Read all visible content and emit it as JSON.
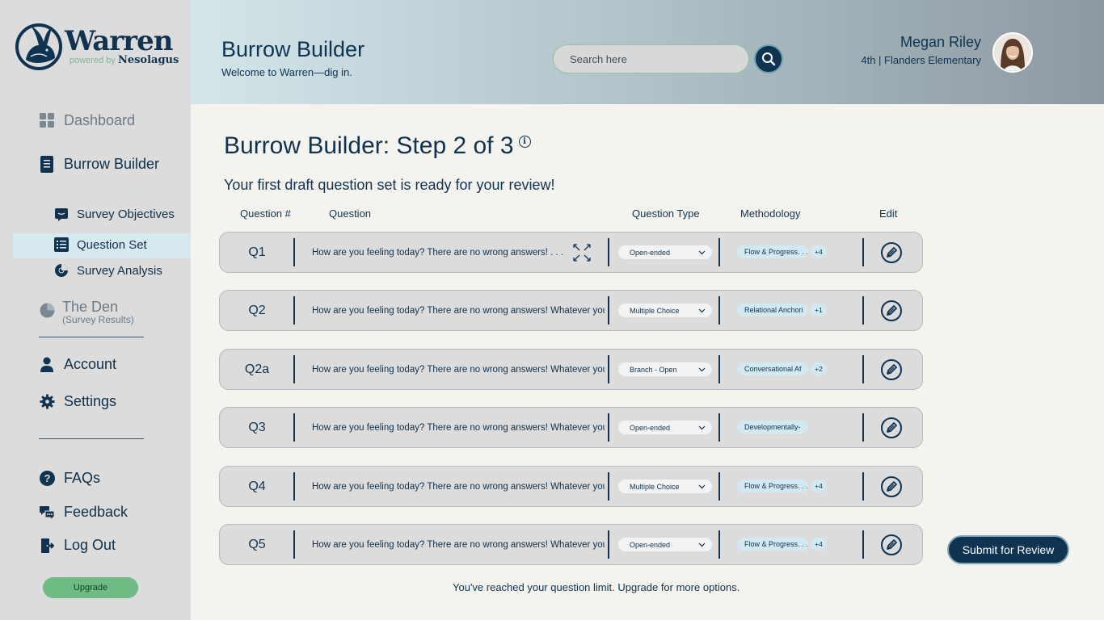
{
  "brand": {
    "name": "Warren",
    "powered_prefix": "powered by",
    "powered_name": "Nesolagus"
  },
  "sidebar": {
    "dashboard": "Dashboard",
    "burrow_builder": "Burrow Builder",
    "survey_objectives": "Survey Objectives",
    "question_set": "Question Set",
    "survey_analysis": "Survey Analysis",
    "the_den": "The Den",
    "the_den_sub": "(Survey Results)",
    "account": "Account",
    "settings": "Settings",
    "faqs": "FAQs",
    "feedback": "Feedback",
    "logout": "Log Out",
    "upgrade": "Upgrade"
  },
  "header": {
    "title": "Burrow Builder",
    "subtitle": "Welcome to Warren—dig in.",
    "search_placeholder": "Search here",
    "user_name": "Megan Riley",
    "user_meta": "4th | Flanders Elementary"
  },
  "main": {
    "title": "Burrow Builder: Step 2 of 3",
    "info_glyph": "i",
    "lead": "Your first draft question set is ready for your review!",
    "columns": {
      "num": "Question #",
      "question": "Question",
      "type": "Question Type",
      "method": "Methodology",
      "edit": "Edit"
    },
    "questions": [
      {
        "num": "Q1",
        "text": "How are you feeling today? There are no wrong answers! . . .",
        "type": "Open-ended",
        "method": "Flow & Progress. . .",
        "more": "+4"
      },
      {
        "num": "Q2",
        "text": "How are you feeling today? There are no wrong answers! Whatever you . . .",
        "type": "Multiple Choice",
        "method": "Relational Anchori",
        "more": "+1"
      },
      {
        "num": "Q2a",
        "text": "How are you feeling today? There are no wrong answers! Whatever you . . .",
        "type": "Branch - Open",
        "method": "Conversational Af",
        "more": "+2"
      },
      {
        "num": "Q3",
        "text": "How are you feeling today? There are no wrong answers! Whatever you . . .",
        "type": "Open-ended",
        "method": "Developmentally-",
        "more": ""
      },
      {
        "num": "Q4",
        "text": "How are you feeling today? There are no wrong answers! Whatever you . . .",
        "type": "Multiple Choice",
        "method": "Flow & Progress. . .",
        "more": "+4"
      },
      {
        "num": "Q5",
        "text": "How are you feeling today? There are no wrong answers! Whatever you . . .",
        "type": "Open-ended",
        "method": "Flow & Progress. . .",
        "more": "+4"
      }
    ],
    "limit_note": "You've reached your question limit. Upgrade for more options.",
    "submit": "Submit for Review"
  },
  "colors": {
    "navy": "#0f3350",
    "sidebar_bg": "#dcdcdc",
    "active_bg": "#d6e9ee",
    "upgrade": "#6fbb84",
    "chip": "#d2e9f2"
  },
  "icons": [
    "rabbit-logo-icon",
    "dashboard-icon",
    "builder-icon",
    "objectives-icon",
    "question-set-icon",
    "analysis-icon",
    "den-icon",
    "account-icon",
    "settings-icon",
    "faq-icon",
    "feedback-icon",
    "logout-icon",
    "search-icon",
    "info-icon",
    "expand-icon",
    "chevron-down-icon",
    "edit-icon"
  ]
}
